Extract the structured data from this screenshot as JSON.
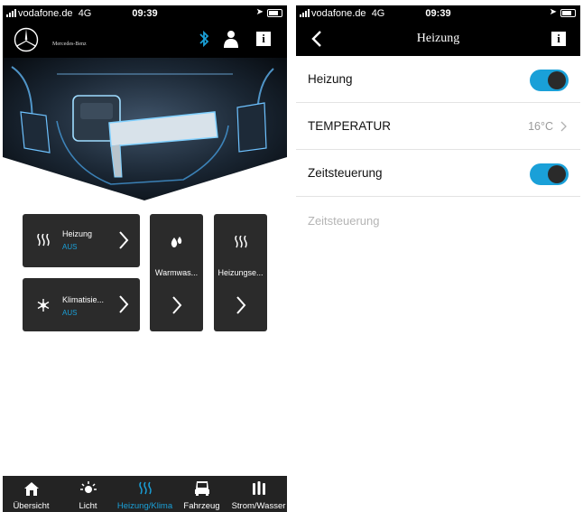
{
  "left": {
    "status": {
      "carrier": "vodafone.de",
      "network": "4G",
      "time": "09:39"
    },
    "brand": {
      "wordmark": "Mercedes-Benz"
    },
    "tiles": [
      {
        "id": "heizung",
        "label": "Heizung",
        "state": "AUS",
        "icon": "heater-icon"
      },
      {
        "id": "klima",
        "label": "Klimatisie...",
        "state": "AUS",
        "icon": "snowflake-icon"
      },
      {
        "id": "warmwasser",
        "label": "Warmwas...",
        "icon": "water-drops-icon"
      },
      {
        "id": "heizungse",
        "label": "Heizungse...",
        "icon": "heater-icon"
      }
    ],
    "tabbar": [
      {
        "label": "Übersicht",
        "icon": "home-icon",
        "active": false
      },
      {
        "label": "Licht",
        "icon": "light-icon",
        "active": false
      },
      {
        "label": "Heizung/Klima",
        "icon": "heater-icon",
        "active": true
      },
      {
        "label": "Fahrzeug",
        "icon": "van-icon",
        "active": false
      },
      {
        "label": "Strom/Wasser",
        "icon": "battery-icon",
        "active": false
      }
    ]
  },
  "right": {
    "status": {
      "carrier": "vodafone.de",
      "network": "4G",
      "time": "09:39"
    },
    "nav": {
      "title": "Heizung"
    },
    "rows": {
      "heizung": {
        "label": "Heizung",
        "on": true
      },
      "temperatur": {
        "label": "TEMPERATUR",
        "value": "16°C"
      },
      "zeitsteuerung": {
        "label": "Zeitsteuerung",
        "on": true
      }
    },
    "section_label": "Zeitsteuerung"
  },
  "colors": {
    "accent": "#1aa0d8",
    "bar": "#000000",
    "tile": "#2b2b2b",
    "tabbar": "#232323",
    "divider": "#e3e3e3"
  }
}
